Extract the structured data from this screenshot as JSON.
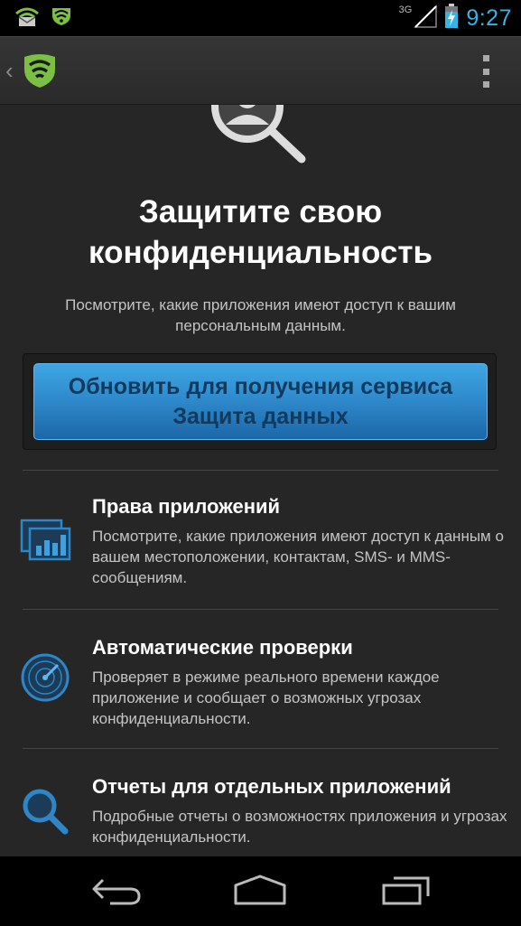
{
  "status_bar": {
    "network_type": "3G",
    "time": "9:27",
    "notification_icons": [
      "envelope-wifi-icon",
      "wifi-shield-icon"
    ],
    "accent_color": "#33b5e5"
  },
  "action_bar": {
    "logo_icon": "green-shield-wifi-icon",
    "overflow_icon": "overflow-menu-icon",
    "brand_color": "#7bc043"
  },
  "hero": {
    "title_line1": "Защитите свою",
    "title_line2": "конфиденциальность",
    "subtitle_line1": "Посмотрите, какие приложения имеют доступ к вашим",
    "subtitle_line2": "персональным данным.",
    "icon": "magnifier-person-icon"
  },
  "upgrade_button": {
    "line1": "Обновить для получения сервиса",
    "line2": "Защита данных"
  },
  "features": [
    {
      "icon": "charts-icon",
      "title": "Права приложений",
      "description": "Посмотрите, какие приложения имеют доступ к данным о вашем местоположении, контактам, SMS- и MMS-сообщениям."
    },
    {
      "icon": "radar-icon",
      "title": "Автоматические проверки",
      "description": "Проверяет в режиме реального времени каждое приложение и сообщает о возможных угрозах конфиденциальности."
    },
    {
      "icon": "search-icon",
      "title": "Отчеты для отдельных приложений",
      "description": "Подробные отчеты о возможностях приложения и угрозах конфиденциальности."
    }
  ],
  "nav_bar": {
    "buttons": [
      "back-icon",
      "home-icon",
      "recent-apps-icon"
    ]
  }
}
